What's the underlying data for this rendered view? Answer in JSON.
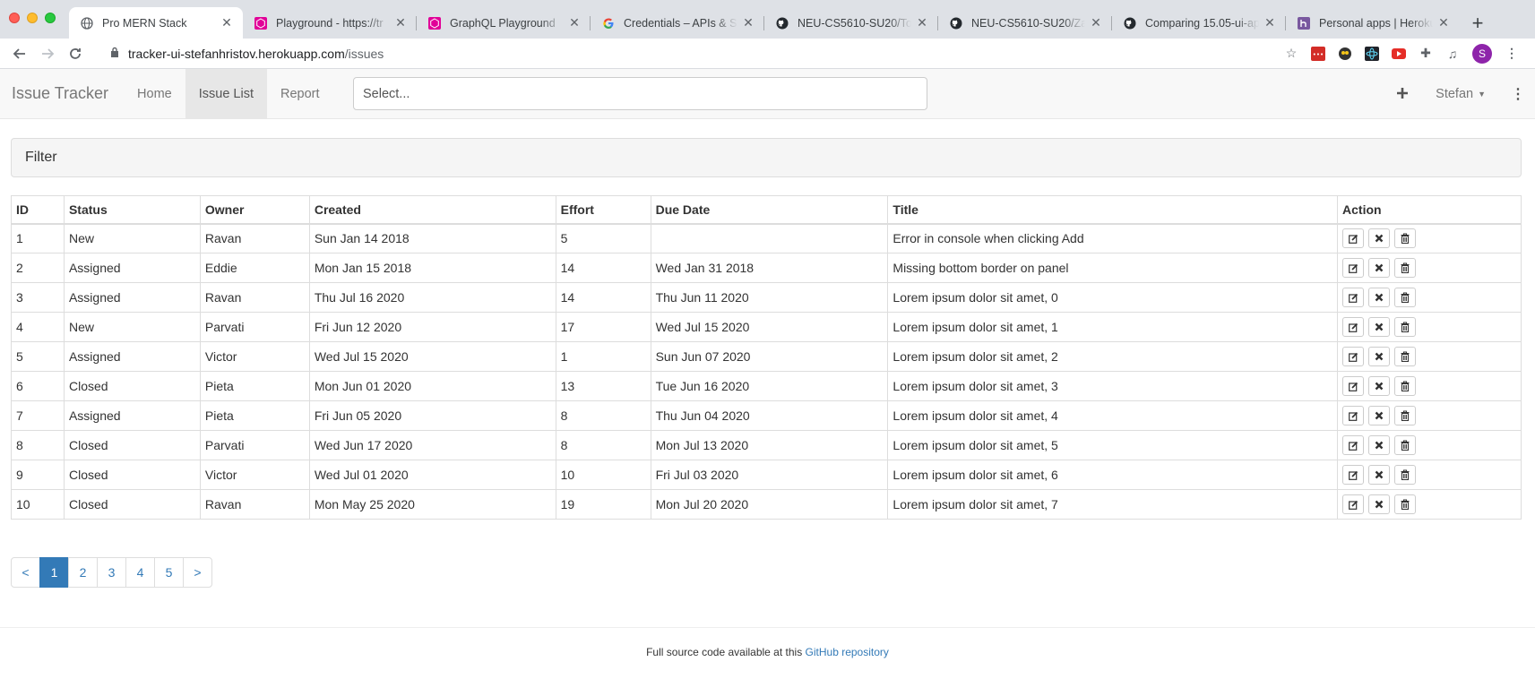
{
  "browser": {
    "tabs": [
      {
        "title": "Pro MERN Stack",
        "icon": "globe-icon",
        "active": true
      },
      {
        "title": "Playground - https://tr",
        "icon": "graphql-pink-icon",
        "active": false
      },
      {
        "title": "GraphQL Playground",
        "icon": "graphql-pink-icon",
        "active": false
      },
      {
        "title": "Credentials – APIs & Se",
        "icon": "google-icon",
        "active": false
      },
      {
        "title": "NEU-CS5610-SU20/To",
        "icon": "github-icon",
        "active": false
      },
      {
        "title": "NEU-CS5610-SU20/Za",
        "icon": "github-icon",
        "active": false
      },
      {
        "title": "Comparing 15.05-ui-ap",
        "icon": "github-icon",
        "active": false
      },
      {
        "title": "Personal apps | Heroku",
        "icon": "heroku-icon",
        "active": false
      }
    ],
    "url_host": "tracker-ui-stefanhristov.herokuapp.com",
    "url_path": "/issues",
    "profile_initial": "S"
  },
  "navbar": {
    "brand": "Issue Tracker",
    "links": [
      "Home",
      "Issue List",
      "Report"
    ],
    "active_link": "Issue List",
    "search_placeholder": "Select...",
    "user": "Stefan"
  },
  "filter": {
    "title": "Filter"
  },
  "table": {
    "headers": [
      "ID",
      "Status",
      "Owner",
      "Created",
      "Effort",
      "Due Date",
      "Title",
      "Action"
    ],
    "rows": [
      [
        "1",
        "New",
        "Ravan",
        "Sun Jan 14 2018",
        "5",
        "",
        "Error in console when clicking Add"
      ],
      [
        "2",
        "Assigned",
        "Eddie",
        "Mon Jan 15 2018",
        "14",
        "Wed Jan 31 2018",
        "Missing bottom border on panel"
      ],
      [
        "3",
        "Assigned",
        "Ravan",
        "Thu Jul 16 2020",
        "14",
        "Thu Jun 11 2020",
        "Lorem ipsum dolor sit amet, 0"
      ],
      [
        "4",
        "New",
        "Parvati",
        "Fri Jun 12 2020",
        "17",
        "Wed Jul 15 2020",
        "Lorem ipsum dolor sit amet, 1"
      ],
      [
        "5",
        "Assigned",
        "Victor",
        "Wed Jul 15 2020",
        "1",
        "Sun Jun 07 2020",
        "Lorem ipsum dolor sit amet, 2"
      ],
      [
        "6",
        "Closed",
        "Pieta",
        "Mon Jun 01 2020",
        "13",
        "Tue Jun 16 2020",
        "Lorem ipsum dolor sit amet, 3"
      ],
      [
        "7",
        "Assigned",
        "Pieta",
        "Fri Jun 05 2020",
        "8",
        "Thu Jun 04 2020",
        "Lorem ipsum dolor sit amet, 4"
      ],
      [
        "8",
        "Closed",
        "Parvati",
        "Wed Jun 17 2020",
        "8",
        "Mon Jul 13 2020",
        "Lorem ipsum dolor sit amet, 5"
      ],
      [
        "9",
        "Closed",
        "Victor",
        "Wed Jul 01 2020",
        "10",
        "Fri Jul 03 2020",
        "Lorem ipsum dolor sit amet, 6"
      ],
      [
        "10",
        "Closed",
        "Ravan",
        "Mon May 25 2020",
        "19",
        "Mon Jul 20 2020",
        "Lorem ipsum dolor sit amet, 7"
      ]
    ],
    "action_icons": [
      "edit-icon",
      "close-icon",
      "trash-icon"
    ]
  },
  "pagination": {
    "prev": "<",
    "pages": [
      "1",
      "2",
      "3",
      "4",
      "5"
    ],
    "active": "1",
    "next": ">"
  },
  "footer": {
    "text": "Full source code available at this",
    "link": "GitHub repository"
  },
  "colors": {
    "primary": "#337ab7",
    "navbar_bg": "#f8f8f8",
    "panel_bg": "#f5f5f5",
    "tabstrip_bg": "#dee1e6"
  }
}
